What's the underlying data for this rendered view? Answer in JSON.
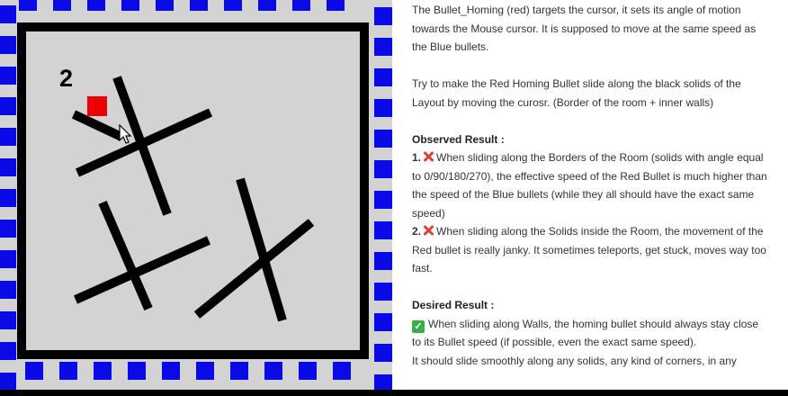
{
  "game": {
    "score": "2",
    "colors": {
      "background": "#d3d3d3",
      "wall": "#000000",
      "blue_bullet": "#0a0ae6",
      "red_bullet": "#ee0000"
    }
  },
  "description": {
    "intro_lines": [
      "The Bullet_Homing (red) targets the cursor, it sets its angle of motion",
      "towards the Mouse cursor. It is supposed to move at the same speed as",
      "the Blue bullets."
    ],
    "instruction_lines": [
      "Try to make the Red Homing Bullet slide along the black solids of the",
      "Layout by moving the curosr. (Border of the room + inner walls)"
    ],
    "observed_heading": "Observed Result :",
    "observed_items": [
      {
        "number": "1.",
        "icon": "cross-mark-icon",
        "lines": [
          "When sliding along the Borders of the Room (solids with angle equal",
          "to 0/90/180/270), the effective speed of the Red Bullet is much higher than",
          "the speed of the Blue bullets (while they all should have the exact same",
          "speed)"
        ]
      },
      {
        "number": "2.",
        "icon": "cross-mark-icon",
        "lines": [
          "When sliding along the Solids inside the Room, the movement of the",
          "Red bullet is really janky. It sometimes teleports, get stuck, moves way too",
          "fast."
        ]
      }
    ],
    "desired_heading": "Desired Result :",
    "desired_icon": "check-mark-icon",
    "desired_lines": [
      "When sliding along Walls, the homing bullet should always stay close",
      "to its Bullet speed (if possible, even the exact same speed).",
      "It should slide smoothly along any solids, any kind of corners, in any"
    ]
  }
}
